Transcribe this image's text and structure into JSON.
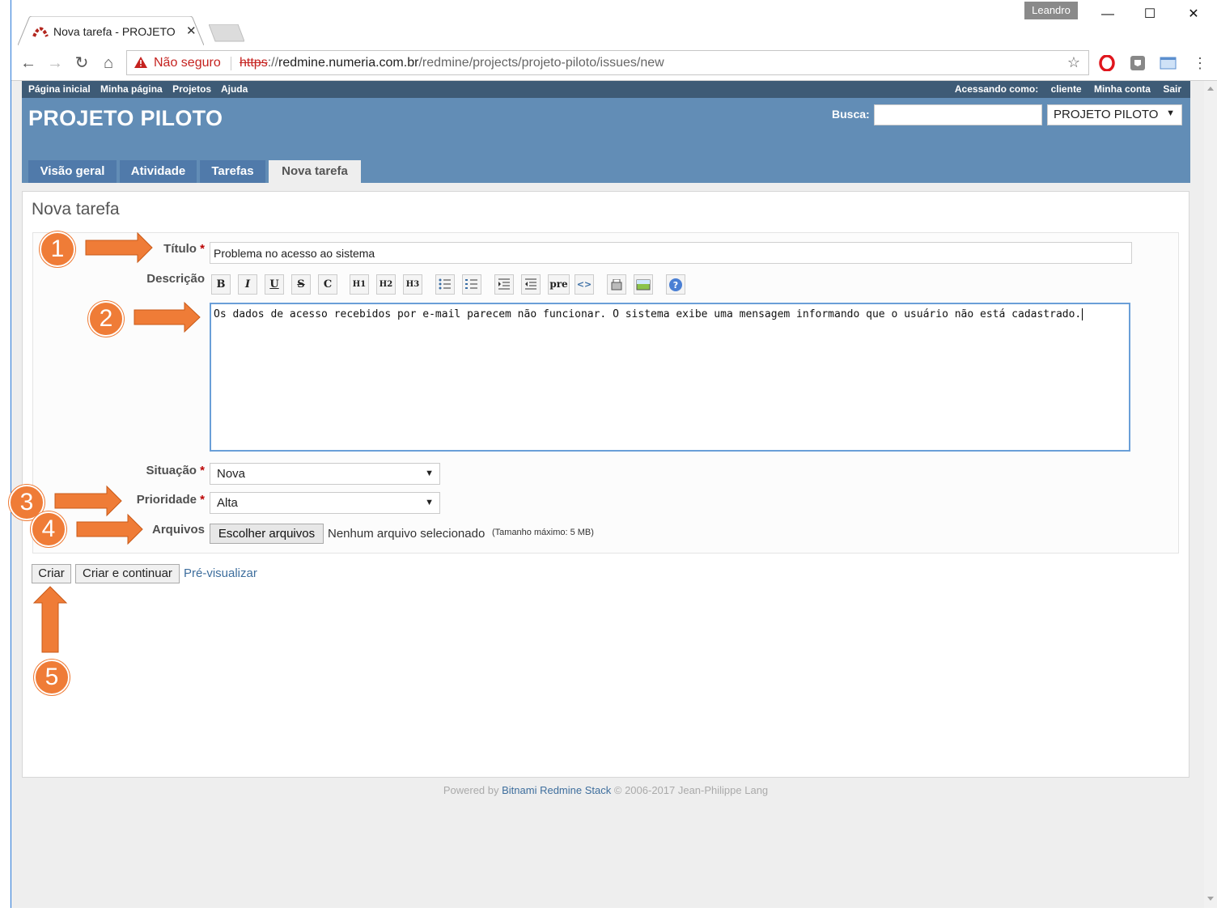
{
  "browser": {
    "tab_title": "Nova tarefa - PROJETO P",
    "tab_close": "✕",
    "profile_name": "Leandro",
    "omnibox": {
      "security_label": "Não seguro",
      "url_scheme": "https",
      "url_sep": "://",
      "url_host": "redmine.numeria.com.br",
      "url_path": "/redmine/projects/projeto-piloto/issues/new"
    },
    "icons": [
      "back-icon",
      "forward-icon",
      "reload-icon",
      "home-icon",
      "warning-icon",
      "star-icon",
      "opera-icon",
      "extension-icon",
      "cast-icon",
      "menu-icon"
    ],
    "window_controls": {
      "minimize": "—",
      "maximize": "☐",
      "close": "✕"
    }
  },
  "top_menu": {
    "left": [
      "Página inicial",
      "Minha página",
      "Projetos",
      "Ajuda"
    ],
    "logged_as_prefix": "Acessando como:",
    "logged_as_user": "cliente",
    "my_account": "Minha conta",
    "logout": "Sair"
  },
  "header": {
    "project_title": "PROJETO PILOTO",
    "search_label": "Busca:",
    "search_value": "",
    "project_jump": "PROJETO PILOTO"
  },
  "main_tabs": [
    {
      "label": "Visão geral",
      "selected": false
    },
    {
      "label": "Atividade",
      "selected": false
    },
    {
      "label": "Tarefas",
      "selected": false
    },
    {
      "label": "Nova tarefa",
      "selected": true
    }
  ],
  "form": {
    "page_title": "Nova tarefa",
    "titulo_label": "Título",
    "titulo_value": "Problema no acesso ao sistema",
    "descricao_label": "Descrição",
    "descricao_value": "Os dados de acesso recebidos por e-mail parecem não funcionar. O sistema exibe uma mensagem informando que o usuário não está cadastrado.",
    "toolbar": [
      "B",
      "I",
      "U",
      "S",
      "C",
      "H1",
      "H2",
      "H3",
      "ul",
      "ol",
      "indent-right",
      "indent-left",
      "pre",
      "code",
      "table",
      "image",
      "help"
    ],
    "situacao_label": "Situação",
    "situacao_value": "Nova",
    "prioridade_label": "Prioridade",
    "prioridade_value": "Alta",
    "arquivos_label": "Arquivos",
    "file_button": "Escolher arquivos",
    "file_none": "Nenhum arquivo selecionado",
    "file_max": "(Tamanho máximo: 5 MB)",
    "required_mark": "*"
  },
  "actions": {
    "create": "Criar",
    "create_continue": "Criar e continuar",
    "preview": "Pré-visualizar"
  },
  "footer": {
    "prefix": "Powered by",
    "link": "Bitnami Redmine Stack",
    "suffix": "© 2006-2017 Jean-Philippe Lang"
  },
  "annotations": {
    "step_1": "1",
    "step_2": "2",
    "step_3": "3",
    "step_4": "4",
    "step_5": "5",
    "color": "#ef7c37"
  }
}
